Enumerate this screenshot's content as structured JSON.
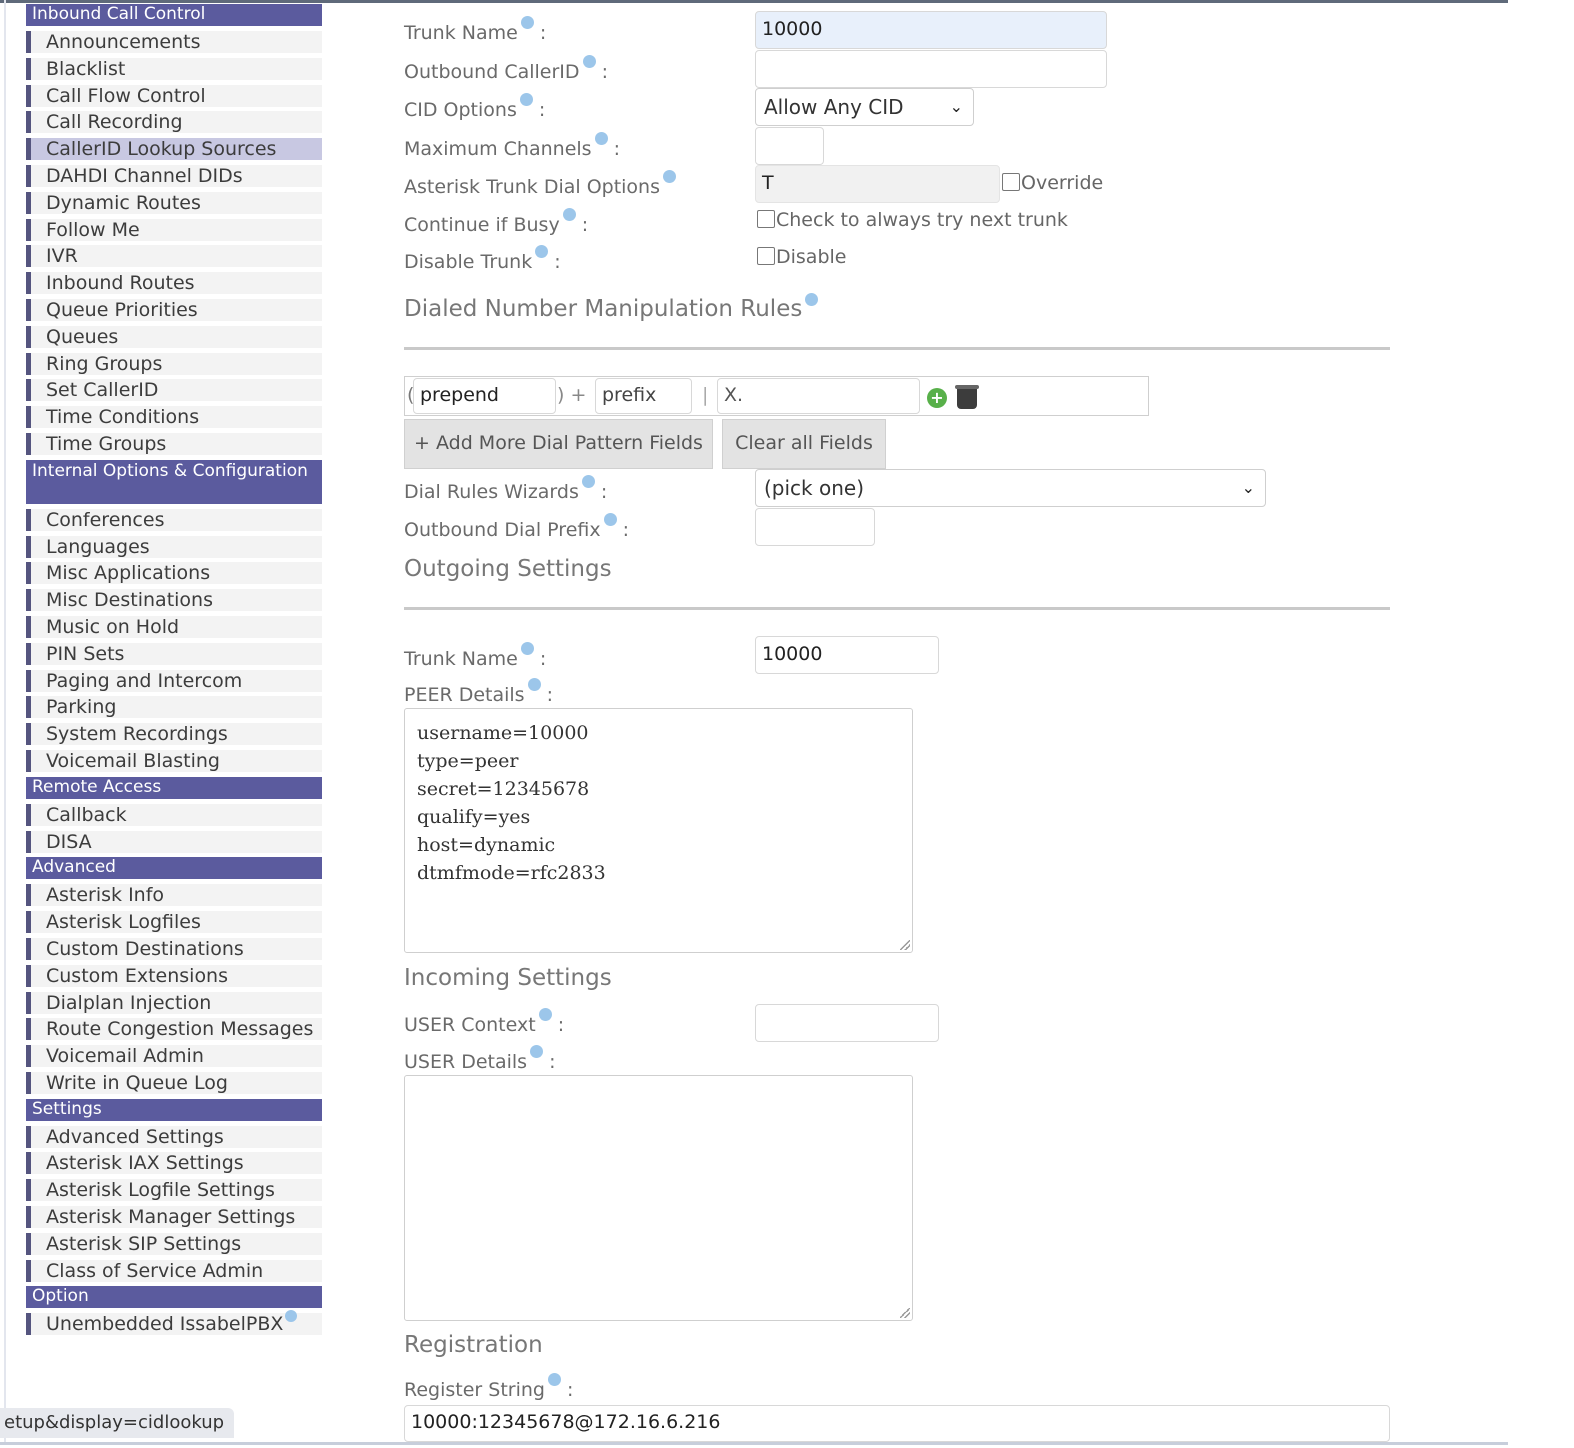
{
  "sidebar": {
    "sections": [
      {
        "title": "Inbound Call Control",
        "items": [
          "Announcements",
          "Blacklist",
          "Call Flow Control",
          "Call Recording",
          "CallerID Lookup Sources",
          "DAHDI Channel DIDs",
          "Dynamic Routes",
          "Follow Me",
          "IVR",
          "Inbound Routes",
          "Queue Priorities",
          "Queues",
          "Ring Groups",
          "Set CallerID",
          "Time Conditions",
          "Time Groups"
        ]
      },
      {
        "title": "Internal Options & Configuration",
        "items": [
          "Conferences",
          "Languages",
          "Misc Applications",
          "Misc Destinations",
          "Music on Hold",
          "PIN Sets",
          "Paging and Intercom",
          "Parking",
          "System Recordings",
          "Voicemail Blasting"
        ]
      },
      {
        "title": "Remote Access",
        "items": [
          "Callback",
          "DISA"
        ]
      },
      {
        "title": "Advanced",
        "items": [
          "Asterisk Info",
          "Asterisk Logfiles",
          "Custom Destinations",
          "Custom Extensions",
          "Dialplan Injection",
          "Route Congestion Messages",
          "Voicemail Admin",
          "Write in Queue Log"
        ]
      },
      {
        "title": "Settings",
        "items": [
          "Advanced Settings",
          "Asterisk IAX Settings",
          "Asterisk Logfile Settings",
          "Asterisk Manager Settings",
          "Asterisk SIP Settings",
          "Class of Service Admin"
        ]
      },
      {
        "title": "Option",
        "items": [
          "Unembedded IssabelPBX"
        ]
      }
    ],
    "active_item": "CallerID Lookup Sources"
  },
  "status_url": "etup&display=cidlookup",
  "form": {
    "trunk_name_label": "Trunk Name",
    "trunk_name_value": "10000",
    "outbound_callerid_label": "Outbound CallerID",
    "outbound_callerid_value": "",
    "cid_options_label": "CID Options",
    "cid_options_value": "Allow Any CID",
    "max_channels_label": "Maximum Channels",
    "max_channels_value": "",
    "dial_options_label": "Asterisk Trunk Dial Options",
    "dial_options_value": "T",
    "override_label": "Override",
    "continue_busy_label": "Continue if Busy",
    "continue_busy_check": "Check to always try next trunk",
    "disable_trunk_label": "Disable Trunk",
    "disable_check": "Disable",
    "colon": ":"
  },
  "dial_rules": {
    "title": "Dialed Number Manipulation Rules",
    "prepend_placeholder": "prepend",
    "prefix_placeholder": "prefix",
    "pattern_value": "X.",
    "open_paren": "(",
    "close_plus": ") +",
    "pipe": "|",
    "add_more_button": "+ Add More Dial Pattern Fields",
    "clear_button": "Clear all Fields",
    "wizards_label": "Dial Rules Wizards",
    "wizards_value": "(pick one)",
    "outbound_prefix_label": "Outbound Dial Prefix",
    "outbound_prefix_value": ""
  },
  "outgoing": {
    "title": "Outgoing Settings",
    "trunk_name_label": "Trunk Name",
    "trunk_name_value": "10000",
    "peer_details_label": "PEER Details",
    "peer_details_lines": [
      "username=10000",
      "type=peer",
      "secret=12345678",
      "qualify=yes",
      "host=dynamic",
      "dtmfmode=rfc2833"
    ]
  },
  "incoming": {
    "title": "Incoming Settings",
    "user_context_label": "USER Context",
    "user_context_value": "",
    "user_details_label": "USER Details",
    "user_details_value": ""
  },
  "registration": {
    "title": "Registration",
    "register_string_label": "Register String",
    "register_string_value": "10000:12345678@172.16.6.216"
  },
  "colors": {
    "sidebar_header": "#5b5b9e",
    "active_item": "#c8c8e2",
    "hint_icon": "#9cc6ea",
    "add_icon": "#58b04a"
  }
}
